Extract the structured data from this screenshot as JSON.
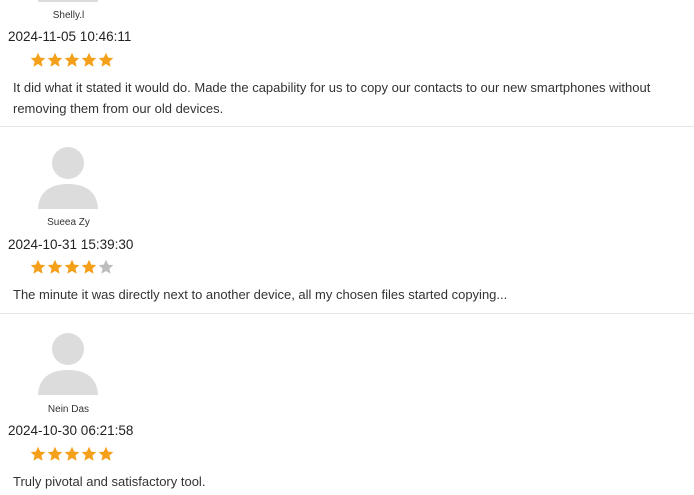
{
  "reviews": [
    {
      "user": "Shelly.l",
      "date": "2024-11-05 10:46:11",
      "rating": 5,
      "text": "It did what it stated it would do. Made the capability for us to copy our contacts to our new smartphones without removing them from our old devices."
    },
    {
      "user": "Sueea Zy",
      "date": "2024-10-31 15:39:30",
      "rating": 4,
      "text": "The minute it was directly next to another device, all my chosen files started copying..."
    },
    {
      "user": "Nein Das",
      "date": "2024-10-30 06:21:58",
      "rating": 5,
      "text": "Truly pivotal and satisfactory tool."
    }
  ],
  "colors": {
    "star_filled": "#F5A01A",
    "star_empty": "#BDBDBD",
    "avatar": "#DCDCDC",
    "divider": "#E3E3E3"
  }
}
